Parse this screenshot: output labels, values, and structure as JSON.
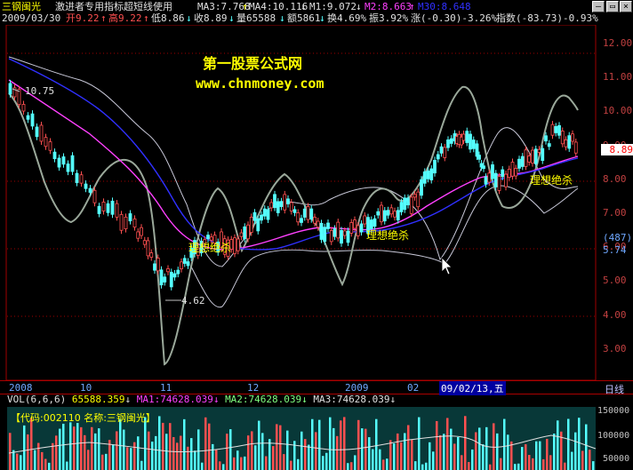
{
  "header": {
    "stock_name": "三钢闽光",
    "indicator_title": "激进者专用指标超短线使用",
    "ma3": "MA3:7.768",
    "ma4": "MA4:10.116",
    "m1": "M1:9.072",
    "m2": "M2:8.663",
    "m30": "M30:8.648",
    "date": "2009/03/30",
    "open": "开9.22",
    "high": "高9.22",
    "low": "低8.86",
    "close": "收8.89",
    "volume": "量65588",
    "amount": "额5861",
    "turnover": "换4.69%",
    "amplitude": "振3.92%",
    "change": "涨(-0.30)-3.26%",
    "index": "指数(-83.73)-0.93%"
  },
  "watermark": {
    "title": "第一股票公式网",
    "url": "www.chnmoney.com"
  },
  "annotations": {
    "high_price": "10.75",
    "low_price": "4.62",
    "signal_1": "理想绝杀",
    "signal_2": "理想绝杀",
    "signal_3": "理想绝杀"
  },
  "y_axis": {
    "ticks": [
      "12.00",
      "11.00",
      "10.00",
      "9.00",
      "8.00",
      "7.00",
      "6.00",
      "5.00",
      "4.00",
      "3.00"
    ],
    "current_price": "8.89",
    "count_badge": "(487)",
    "bottom_value": "5.74"
  },
  "x_axis": {
    "labels": [
      "2008",
      "10",
      "11",
      "12",
      "2009",
      "02"
    ],
    "cursor_date": "09/02/13,五",
    "period": "日线"
  },
  "volume_panel": {
    "params": "VOL(6,6,6)",
    "vol": "65588.359",
    "ma1": "MA1:74628.039",
    "ma2": "MA2:74628.039",
    "ma3": "MA3:74628.039",
    "code_label": "【代码:002110 名称:三钢闽光】",
    "ticks": [
      "150000",
      "100000",
      "50000"
    ]
  },
  "colors": {
    "up": "#ff5050",
    "down": "#54ffff",
    "ma_blue": "#3030ff",
    "ma_magenta": "#ff40ff",
    "band_gray": "#9aa89a",
    "thin_band": "#c8c8d8",
    "text_yellow": "#ffff00",
    "axis_red": "#c00000"
  }
}
